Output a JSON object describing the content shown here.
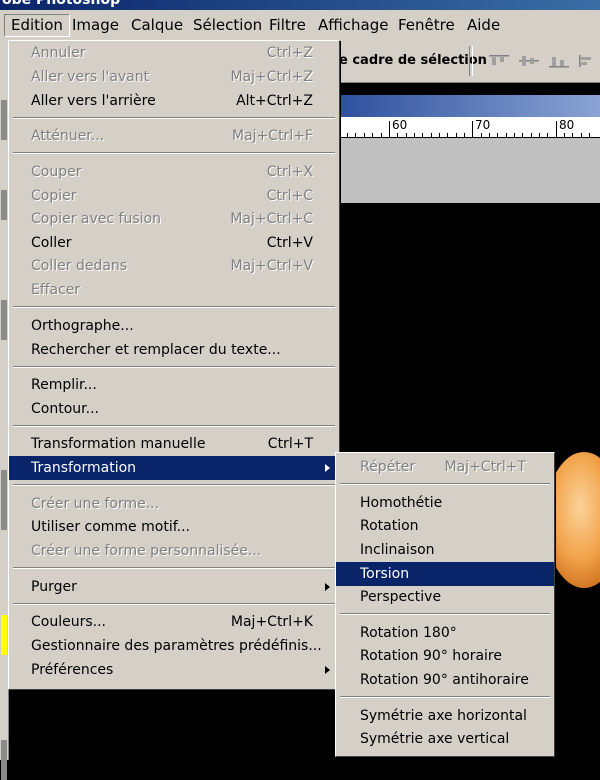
{
  "window": {
    "title": "obe Photoshop"
  },
  "menubar": {
    "items": [
      "Edition",
      "Image",
      "Calque",
      "Sélection",
      "Filtre",
      "Affichage",
      "Fenêtre",
      "Aide"
    ]
  },
  "toolbar": {
    "selection_text": "e cadre de sélection"
  },
  "ruler": {
    "labels": [
      "60",
      "70",
      "80"
    ]
  },
  "edition_menu": {
    "items": [
      {
        "label": "Annuler",
        "shortcut": "Ctrl+Z"
      },
      {
        "label": "Aller vers l'avant",
        "shortcut": "Maj+Ctrl+Z"
      },
      {
        "label": "Aller vers l'arrière",
        "shortcut": "Alt+Ctrl+Z"
      },
      {
        "label": "Atténuer...",
        "shortcut": "Maj+Ctrl+F"
      },
      {
        "label": "Couper",
        "shortcut": "Ctrl+X"
      },
      {
        "label": "Copier",
        "shortcut": "Ctrl+C"
      },
      {
        "label": "Copier avec fusion",
        "shortcut": "Maj+Ctrl+C"
      },
      {
        "label": "Coller",
        "shortcut": "Ctrl+V"
      },
      {
        "label": "Coller dedans",
        "shortcut": "Maj+Ctrl+V"
      },
      {
        "label": "Effacer",
        "shortcut": ""
      },
      {
        "label": "Orthographe...",
        "shortcut": ""
      },
      {
        "label": "Rechercher et remplacer du texte...",
        "shortcut": ""
      },
      {
        "label": "Remplir...",
        "shortcut": ""
      },
      {
        "label": "Contour...",
        "shortcut": ""
      },
      {
        "label": "Transformation manuelle",
        "shortcut": "Ctrl+T"
      },
      {
        "label": "Transformation",
        "shortcut": ""
      },
      {
        "label": "Créer une forme...",
        "shortcut": ""
      },
      {
        "label": "Utiliser comme motif...",
        "shortcut": ""
      },
      {
        "label": "Créer une forme personnalisée...",
        "shortcut": ""
      },
      {
        "label": "Purger",
        "shortcut": ""
      },
      {
        "label": "Couleurs...",
        "shortcut": "Maj+Ctrl+K"
      },
      {
        "label": "Gestionnaire des paramètres prédéfinis...",
        "shortcut": ""
      },
      {
        "label": "Préférences",
        "shortcut": ""
      }
    ]
  },
  "transformation_submenu": {
    "items": [
      {
        "label": "Répéter",
        "shortcut": "Maj+Ctrl+T"
      },
      {
        "label": "Homothétie",
        "shortcut": ""
      },
      {
        "label": "Rotation",
        "shortcut": ""
      },
      {
        "label": "Inclinaison",
        "shortcut": ""
      },
      {
        "label": "Torsion",
        "shortcut": ""
      },
      {
        "label": "Perspective",
        "shortcut": ""
      },
      {
        "label": "Rotation 180°",
        "shortcut": ""
      },
      {
        "label": "Rotation 90° horaire",
        "shortcut": ""
      },
      {
        "label": "Rotation 90° antihoraire",
        "shortcut": ""
      },
      {
        "label": "Symétrie axe horizontal",
        "shortcut": ""
      },
      {
        "label": "Symétrie axe vertical",
        "shortcut": ""
      }
    ]
  }
}
